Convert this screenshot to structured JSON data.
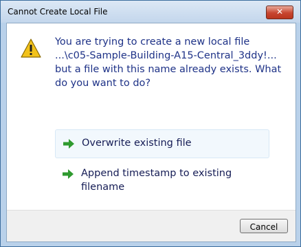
{
  "window": {
    "title": "Cannot Create Local File",
    "close_label": "✕"
  },
  "message": {
    "text": "You are trying to create a new local file\n...\\c05-Sample-Building-A15-Central_3ddy!...\nbut a file with this name already exists. What\ndo you want to do?",
    "icon": "warning-icon"
  },
  "options": [
    {
      "label": "Overwrite existing file",
      "icon": "green-arrow-icon"
    },
    {
      "label": "Append timestamp to existing\nfilename",
      "icon": "green-arrow-icon"
    }
  ],
  "footer": {
    "cancel_label": "Cancel"
  },
  "colors": {
    "message_text": "#1e3287",
    "arrow": "#2f9a2f",
    "warning": "#f2c21b"
  }
}
